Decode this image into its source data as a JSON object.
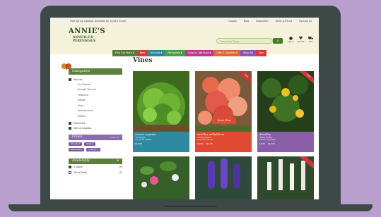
{
  "topbar": {
    "promo": "Free Spring Catalog! Available for Annie's Email!",
    "links": [
      "Classes",
      "Blog",
      "Newsletter",
      "Refer-a-Friend",
      "Contact Us"
    ]
  },
  "logo": {
    "main": "ANNIE'S",
    "sub1": "ANNUALS &",
    "sub2": "PERENNIALS"
  },
  "search": {
    "placeholder": "Search the Plants...",
    "button_icon": "search-icon"
  },
  "header_icons": [
    {
      "icon": "user-icon",
      "label": "Sign In"
    },
    {
      "icon": "heart-icon",
      "label": "Wishlist"
    },
    {
      "icon": "cart-icon",
      "label": "Cart"
    }
  ],
  "nav": [
    {
      "label": "Find Our Plant ▾",
      "color": "#5a7b3a"
    },
    {
      "label": "New",
      "color": "#d83a3a"
    },
    {
      "label": "Annuals ▾",
      "color": "#2c8a9a"
    },
    {
      "label": "Perennials ▾",
      "color": "#4aa04a"
    },
    {
      "label": "Shop by Attribute ▾",
      "color": "#c2368e"
    },
    {
      "label": "Gifts & Supplies ▾",
      "color": "#e0663a"
    },
    {
      "label": "Shop All",
      "color": "#8a56b0"
    },
    {
      "label": "Sale",
      "color": "#d33a3a"
    }
  ],
  "page_title": "Vines",
  "sidebar": {
    "categories_title": "Categories",
    "categories": [
      {
        "label": "Annuals",
        "checked": true
      },
      {
        "label": "Cut Flowers",
        "sub": true
      },
      {
        "label": "Drought Tolerant",
        "sub": true
      },
      {
        "label": "Flowering",
        "sub": true
      },
      {
        "label": "Foliage",
        "sub": true
      },
      {
        "label": "Vines",
        "sub": true
      },
      {
        "label": "Groundcovers",
        "sub": true
      },
      {
        "label": "Edibles",
        "sub": true
      },
      {
        "label": "Perennials",
        "checked": true
      },
      {
        "label": "Gifts & Supplies",
        "checked": true
      }
    ],
    "filters_title": "Filters",
    "clear_all": "Clear All",
    "chips": [
      "Annuals ✕",
      "Vines ✕",
      "Perennials ✕",
      "In Stock ✕"
    ],
    "availability_title": "Availability",
    "availability": [
      {
        "label": "In Stock",
        "count": "(9)",
        "checked": true
      },
      {
        "label": "Out of Stock",
        "count": "(2)",
        "checked": false
      }
    ]
  },
  "products": [
    {
      "name": "Acacia cognata",
      "common": "'Limelight'",
      "extra": "Cousin Itt Wattle",
      "price": "$13.95",
      "price_old": "",
      "color": "#2e8aa0",
      "sale": false,
      "quick_view": ""
    },
    {
      "name": "Achillea millefolium",
      "common": "'Cerise Queen'",
      "extra": "Common Yarrow",
      "price": "$9.95",
      "price_old": "$14.95",
      "color": "#e04a33",
      "sale": true,
      "sale_label": "SALE",
      "quick_view": "Quick View"
    },
    {
      "name": "Abutilon",
      "common": "'Bella Vanilla'",
      "extra": "Flowering Maple",
      "price": "$5.95",
      "price_old": "$13.95",
      "color": "#8a5fa8",
      "sale": true,
      "sale_label": "SALE",
      "quick_view": ""
    }
  ],
  "colors": {
    "background": "#b99fcd",
    "header_bg": "#f4f2d9",
    "brand_green": "#2d4b2a",
    "accent_green": "#5d7e3c",
    "filter_purple": "#8a6dab"
  }
}
